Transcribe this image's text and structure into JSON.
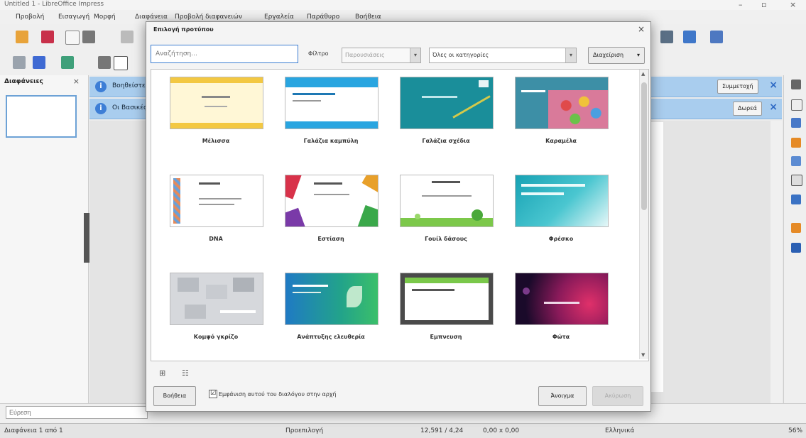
{
  "window": {
    "title": "Untitled 1 - LibreOffice Impress",
    "menu": [
      "Προβολή",
      "Εισαγωγή",
      "Μορφή",
      "Διαφάνεια",
      "Προβολή διαφανειών",
      "Εργαλεία",
      "Παράθυρο",
      "Βοήθεια"
    ]
  },
  "slide_pane": {
    "title": "Διαφάνειες",
    "close": "×"
  },
  "infobars": [
    {
      "text": "Βοηθείστε",
      "button": "Συμμετοχή"
    },
    {
      "text": "Οι Βασικές",
      "button": "Δωρεά"
    }
  ],
  "bottom": {
    "search_placeholder": "Εύρεση"
  },
  "status": {
    "slide": "Διαφάνεια 1 από 1",
    "layout": "Προεπιλογή",
    "coords": "12,591 / 4,24",
    "size": "0,00 x 0,00",
    "lang": "Ελληνικά",
    "zoom": "56%"
  },
  "dialog": {
    "title": "Επιλογή προτύπου",
    "close": "×",
    "search_placeholder": "Αναζήτηση...",
    "filter_label": "Φίλτρο",
    "filter_value": "Παρουσιάσεις",
    "category_value": "Όλες οι κατηγορίες",
    "manage_label": "Διαχείριση",
    "manage_arrow": "▾",
    "templates": [
      {
        "name": "Μέλισσα",
        "style": "bee"
      },
      {
        "name": "Γαλάζια καμπύλη",
        "style": "bluecurve"
      },
      {
        "name": "Γαλάζια σχέδια",
        "style": "blueprint"
      },
      {
        "name": "Καραμέλα",
        "style": "candy"
      },
      {
        "name": "DNA",
        "style": "dna"
      },
      {
        "name": "Εστίαση",
        "style": "focus"
      },
      {
        "name": "Γουίλ δάσους",
        "style": "forest"
      },
      {
        "name": "Φρέσκο",
        "style": "fresh"
      },
      {
        "name": "Κομψό γκρίζο",
        "style": "grey"
      },
      {
        "name": "Ανάπτυξης ελευθερία",
        "style": "growing"
      },
      {
        "name": "Εμπνευση",
        "style": "inspiration"
      },
      {
        "name": "Φώτα",
        "style": "lights"
      }
    ],
    "view_icons": "⊞",
    "view_list": "☷",
    "help_label": "Βοήθεια",
    "startup_check": "☑",
    "startup_label": "Εμφάνιση αυτού του διαλόγου στην αρχή",
    "open_label": "Άνοιγμα",
    "cancel_label": "Ακύρωση"
  }
}
